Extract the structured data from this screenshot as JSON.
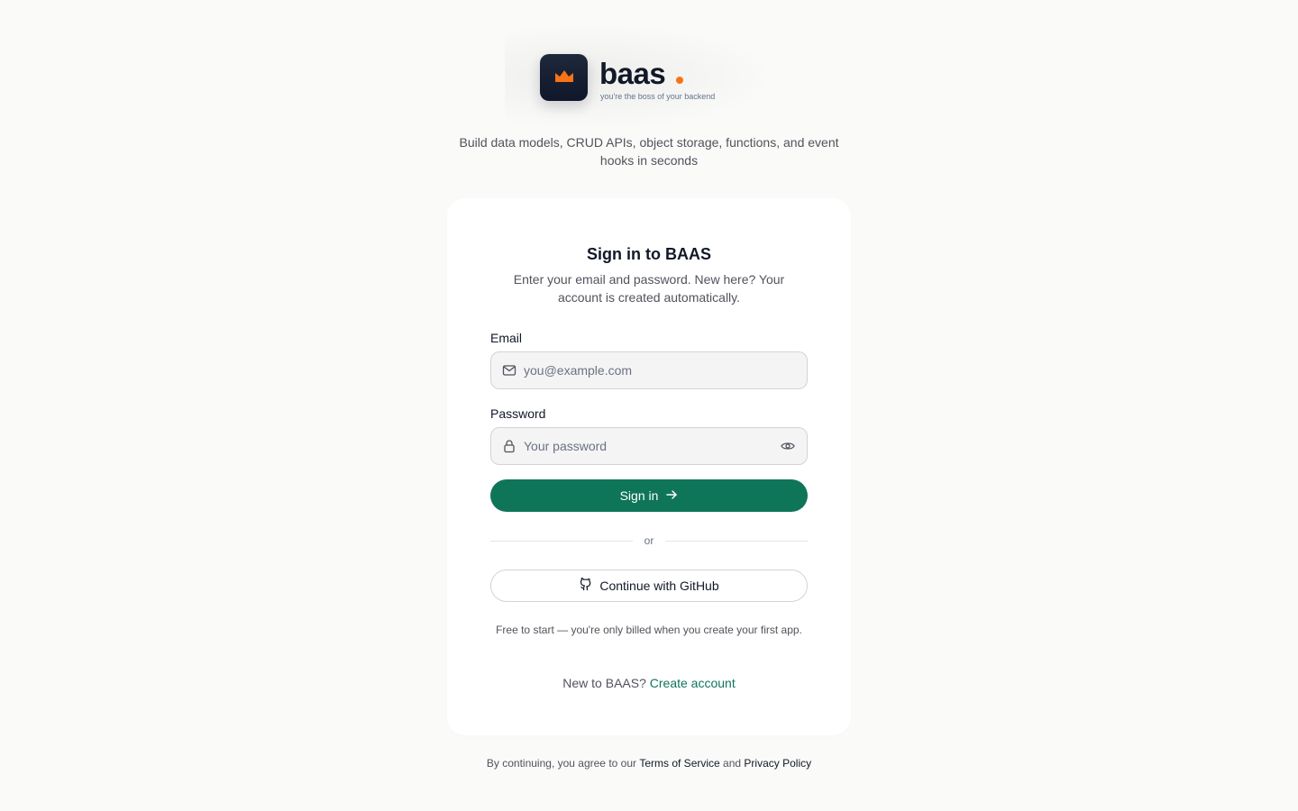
{
  "brand": {
    "name": "baas",
    "tagline": "you're the boss of your backend",
    "accent_color": "#f97316",
    "mark_bg": "#0f172a",
    "icon": "crown-icon"
  },
  "hero": {
    "description": "Build data models, CRUD APIs, object storage, functions, and event hooks in seconds"
  },
  "card": {
    "title": "Sign in to BAAS",
    "subtitle": "Enter your email and password. New here? Your account is created automatically."
  },
  "form": {
    "email_label": "Email",
    "email_placeholder": "you@example.com",
    "email_icon": "mail-icon",
    "password_label": "Password",
    "password_placeholder": "Your password",
    "password_icon": "lock-icon",
    "reveal_icon": "eye-icon",
    "submit_label": "Sign in",
    "submit_icon": "arrow-right-icon",
    "primary_color": "#0f7559"
  },
  "divider": {
    "label": "or"
  },
  "oauth": {
    "github_label": "Continue with GitHub",
    "github_icon": "github-icon"
  },
  "notes": {
    "billing": "Free to start — you're only billed when you create your first app.",
    "new_prefix": "New to BAAS?",
    "create_account": "Create account"
  },
  "legal": {
    "prefix": "By continuing, you agree to our",
    "terms": "Terms of Service",
    "and": "and",
    "privacy": "Privacy Policy"
  }
}
